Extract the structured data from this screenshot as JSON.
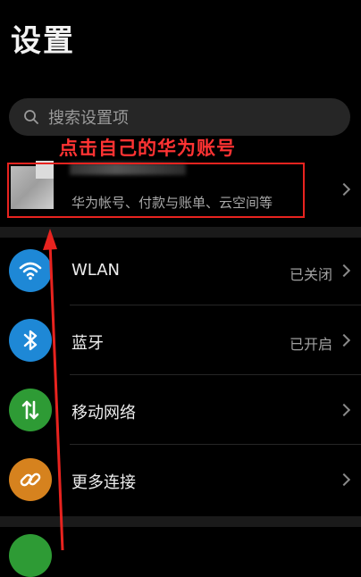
{
  "header": {
    "title": "设置"
  },
  "search": {
    "placeholder": "搜索设置项"
  },
  "annotation": {
    "text": "点击自己的华为账号"
  },
  "account": {
    "subtitle": "华为帐号、付款与账单、云空间等"
  },
  "rows": [
    {
      "label": "WLAN",
      "value": "已关闭",
      "icon": "wifi-icon",
      "color": "#1e88d6"
    },
    {
      "label": "蓝牙",
      "value": "已开启",
      "icon": "bluetooth-icon",
      "color": "#1e88d6"
    },
    {
      "label": "移动网络",
      "value": "",
      "icon": "mobile-data-icon",
      "color": "#2e9b35"
    },
    {
      "label": "更多连接",
      "value": "",
      "icon": "link-icon",
      "color": "#d6821e"
    }
  ],
  "colors": {
    "annotation": "#e8231f",
    "background": "#000000"
  }
}
